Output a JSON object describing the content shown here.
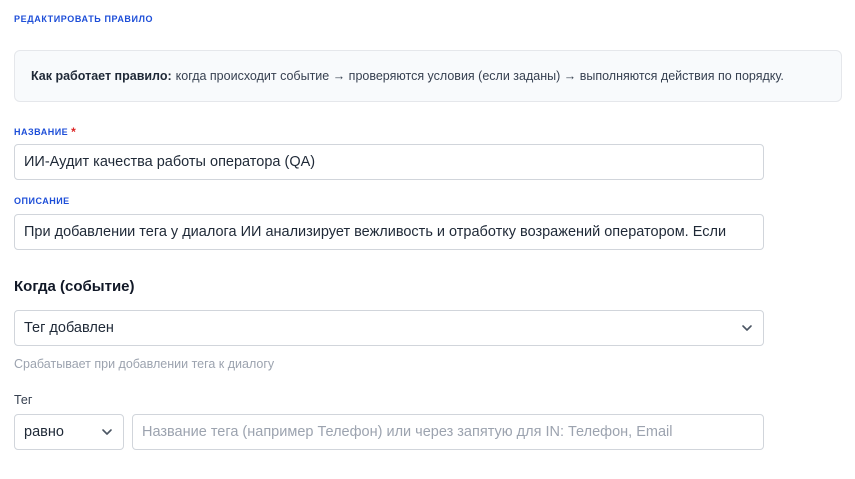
{
  "form": {
    "section_title": "РЕДАКТИРОВАТЬ ПРАВИЛО",
    "info": {
      "bold": "Как работает правило:",
      "text": "когда происходит событие → проверяются условия (если заданы) → выполняются действия по порядку."
    },
    "name": {
      "label": "НАЗВАНИЕ",
      "required_mark": "*",
      "value": "ИИ-Аудит качества работы оператора (QA)"
    },
    "description": {
      "label": "ОПИСАНИЕ",
      "value": "При добавлении тега у диалога ИИ анализирует вежливость и отработку возражений оператором. Если"
    },
    "trigger": {
      "heading": "Когда (событие)",
      "selected": "Тег добавлен",
      "hint": "Срабатывает при добавлении тега к диалогу"
    },
    "tag": {
      "label": "Тег",
      "operator_selected": "равно",
      "placeholder": "Название тега (например Телефон) или через запятую для IN: Телефон, Email"
    }
  },
  "icons": {
    "select_chevron": "chevron-down-icon"
  },
  "colors": {
    "accent": "#1d4ed8",
    "required": "#dc2626",
    "hint": "#9ca3af",
    "border": "#d1d5db",
    "info_bg": "#f8fafc"
  }
}
